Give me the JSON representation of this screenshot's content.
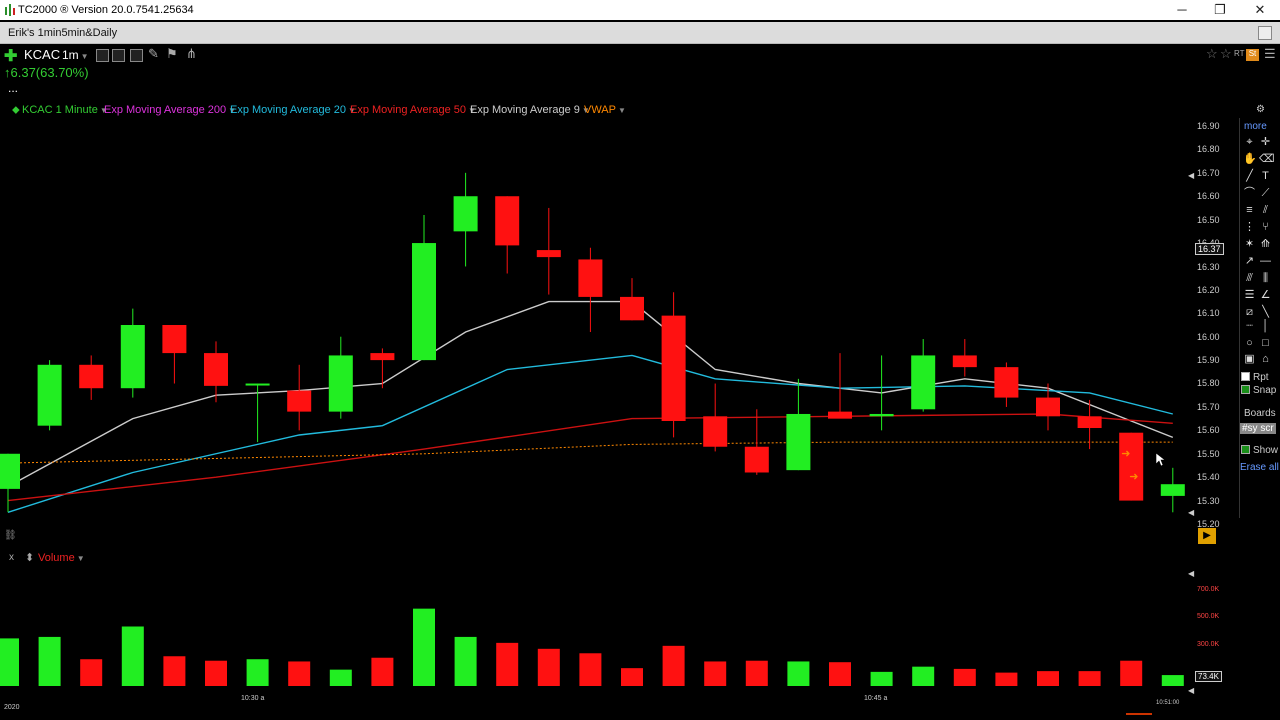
{
  "window": {
    "title": "TC2000 ® Version 20.0.7541.25634",
    "minimize": "─",
    "maximize": "❐",
    "close": "✕"
  },
  "layout": {
    "name": "Erik's 1min5min&Daily"
  },
  "toolbar": {
    "symbol": "KCAC",
    "timeframe": "1m",
    "change": "↑6.37(63.70%)",
    "more_dots": "..."
  },
  "indicators": [
    {
      "label": "KCAC 1 Minute",
      "color": "#33cc33"
    },
    {
      "label": "Exp Moving Average 200",
      "color": "#dd33dd"
    },
    {
      "label": "Exp Moving Average 20",
      "color": "#22bbdd"
    },
    {
      "label": "Exp Moving Average 50",
      "color": "#ee2222"
    },
    {
      "label": "Exp Moving Average 9",
      "color": "#cccccc"
    },
    {
      "label": "VWAP",
      "color": "#ff8800"
    }
  ],
  "price_axis": {
    "ticks": [
      "16.90",
      "16.80",
      "16.70",
      "16.60",
      "16.50",
      "16.40",
      "16.30",
      "16.20",
      "16.10",
      "16.00",
      "15.90",
      "15.80",
      "15.70",
      "15.60",
      "15.50",
      "15.40",
      "15.30",
      "15.20"
    ],
    "last_price_label": "16.37"
  },
  "volume_panel": {
    "title": "Volume",
    "close_x": "x",
    "ticks": [
      "700.0K",
      "500.0K",
      "300.0K"
    ],
    "last_volume_label": "73.4K"
  },
  "time_axis": {
    "labels": [
      "10:30 a",
      "10:45 a"
    ],
    "left_label": "2020",
    "right_label": "10:51:00"
  },
  "sidebar": {
    "more": "more",
    "rpt": "Rpt",
    "snap": "Snap",
    "boards": "Boards",
    "scan_label": "#sy scr",
    "show": "Show",
    "erase_all": "Erase all"
  },
  "chart_data": {
    "type": "candlestick",
    "symbol": "KCAC",
    "interval": "1 Minute",
    "ylim": [
      15.2,
      16.9
    ],
    "volume_ylim": [
      0,
      800000
    ],
    "candles": [
      {
        "o": 15.35,
        "h": 15.5,
        "l": 15.25,
        "c": 15.5,
        "v": 320000
      },
      {
        "o": 15.62,
        "h": 15.9,
        "l": 15.6,
        "c": 15.88,
        "v": 330000
      },
      {
        "o": 15.88,
        "h": 15.92,
        "l": 15.73,
        "c": 15.78,
        "v": 180000
      },
      {
        "o": 15.78,
        "h": 16.12,
        "l": 15.74,
        "c": 16.05,
        "v": 400000
      },
      {
        "o": 16.05,
        "h": 16.05,
        "l": 15.8,
        "c": 15.93,
        "v": 200000
      },
      {
        "o": 15.93,
        "h": 15.98,
        "l": 15.72,
        "c": 15.79,
        "v": 170000
      },
      {
        "o": 15.8,
        "h": 15.8,
        "l": 15.55,
        "c": 15.8,
        "v": 180000
      },
      {
        "o": 15.77,
        "h": 15.88,
        "l": 15.6,
        "c": 15.68,
        "v": 165000
      },
      {
        "o": 15.68,
        "h": 16.0,
        "l": 15.65,
        "c": 15.92,
        "v": 110000
      },
      {
        "o": 15.93,
        "h": 15.95,
        "l": 15.78,
        "c": 15.9,
        "v": 190000
      },
      {
        "o": 15.9,
        "h": 16.52,
        "l": 15.9,
        "c": 16.4,
        "v": 520000
      },
      {
        "o": 16.45,
        "h": 16.7,
        "l": 16.3,
        "c": 16.6,
        "v": 330000
      },
      {
        "o": 16.6,
        "h": 16.6,
        "l": 16.27,
        "c": 16.39,
        "v": 290000
      },
      {
        "o": 16.37,
        "h": 16.55,
        "l": 16.18,
        "c": 16.34,
        "v": 250000
      },
      {
        "o": 16.33,
        "h": 16.38,
        "l": 16.02,
        "c": 16.17,
        "v": 220000
      },
      {
        "o": 16.17,
        "h": 16.25,
        "l": 16.07,
        "c": 16.07,
        "v": 120000
      },
      {
        "o": 16.09,
        "h": 16.19,
        "l": 15.57,
        "c": 15.64,
        "v": 270000
      },
      {
        "o": 15.66,
        "h": 15.8,
        "l": 15.51,
        "c": 15.53,
        "v": 165000
      },
      {
        "o": 15.53,
        "h": 15.69,
        "l": 15.41,
        "c": 15.42,
        "v": 170000
      },
      {
        "o": 15.43,
        "h": 15.82,
        "l": 15.43,
        "c": 15.67,
        "v": 165000
      },
      {
        "o": 15.68,
        "h": 15.93,
        "l": 15.66,
        "c": 15.65,
        "v": 160000
      },
      {
        "o": 15.66,
        "h": 15.92,
        "l": 15.6,
        "c": 15.67,
        "v": 95000
      },
      {
        "o": 15.69,
        "h": 15.99,
        "l": 15.68,
        "c": 15.92,
        "v": 130000
      },
      {
        "o": 15.92,
        "h": 15.99,
        "l": 15.83,
        "c": 15.87,
        "v": 115000
      },
      {
        "o": 15.87,
        "h": 15.89,
        "l": 15.7,
        "c": 15.74,
        "v": 90000
      },
      {
        "o": 15.74,
        "h": 15.8,
        "l": 15.6,
        "c": 15.66,
        "v": 100000
      },
      {
        "o": 15.66,
        "h": 15.73,
        "l": 15.52,
        "c": 15.61,
        "v": 100000
      },
      {
        "o": 15.59,
        "h": 15.59,
        "l": 15.3,
        "c": 15.3,
        "v": 170000
      },
      {
        "o": 15.32,
        "h": 15.44,
        "l": 15.25,
        "c": 15.37,
        "v": 73400
      }
    ],
    "lines": [
      {
        "name": "Exp Moving Average 9",
        "color": "#cccccc",
        "x": [
          0,
          3,
          5,
          7,
          9,
          11,
          13,
          15,
          17,
          19,
          21,
          23,
          25,
          27,
          28
        ],
        "y": [
          15.36,
          15.65,
          15.75,
          15.77,
          15.8,
          16.02,
          16.15,
          16.15,
          15.86,
          15.8,
          15.76,
          15.82,
          15.78,
          15.64,
          15.57
        ]
      },
      {
        "name": "Exp Moving Average 20",
        "color": "#22bbdd",
        "x": [
          0,
          3,
          7,
          9,
          12,
          15,
          17,
          20,
          23,
          26,
          28
        ],
        "y": [
          15.25,
          15.42,
          15.58,
          15.62,
          15.86,
          15.92,
          15.82,
          15.78,
          15.79,
          15.76,
          15.67
        ]
      },
      {
        "name": "Exp Moving Average 50",
        "color": "#cc1111",
        "x": [
          0,
          5,
          10,
          15,
          20,
          25,
          28
        ],
        "y": [
          15.3,
          15.4,
          15.52,
          15.65,
          15.66,
          15.67,
          15.63
        ]
      },
      {
        "name": "VWAP",
        "color": "#ff8800",
        "dashed": true,
        "x": [
          0,
          10,
          15,
          20,
          28
        ],
        "y": [
          15.46,
          15.5,
          15.54,
          15.55,
          15.55
        ]
      }
    ]
  }
}
